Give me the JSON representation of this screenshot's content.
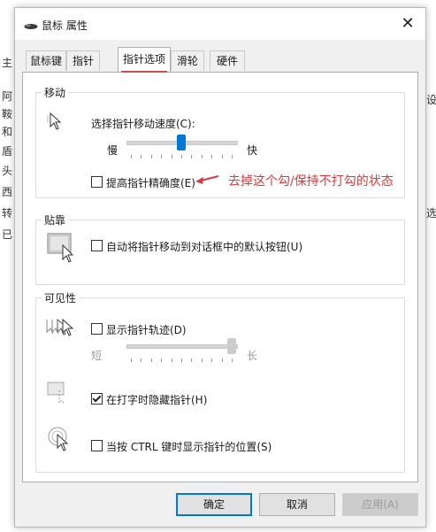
{
  "window": {
    "title": "鼠标 属性",
    "close_label": "✕"
  },
  "tabs": [
    "鼠标键",
    "指针",
    "指针选项",
    "滑轮",
    "硬件"
  ],
  "motion": {
    "group_label": "移动",
    "speed_label": "选择指针移动速度(C):",
    "slow_label": "慢",
    "fast_label": "快",
    "speed_value": 0.5,
    "precision_label": "提高指针精确度(E)",
    "precision_checked": false
  },
  "annotation": "去掉这个勾/保持不打勾的状态",
  "snap": {
    "group_label": "贴靠",
    "snap_label": "自动将指针移动到对话框中的默认按钮(U)",
    "snap_checked": false
  },
  "visibility": {
    "group_label": "可见性",
    "trails_label": "显示指针轨迹(D)",
    "trails_checked": false,
    "short_label": "短",
    "long_label": "长",
    "trails_value": 1.0,
    "hide_label": "在打字时隐藏指针(H)",
    "hide_checked": true,
    "ctrl_label": "当按 CTRL 键时显示指针的位置(S)",
    "ctrl_checked": false
  },
  "buttons": {
    "ok": "确定",
    "cancel": "取消",
    "apply": "应用(A)"
  },
  "colors": {
    "accent": "#0078d7",
    "annotation": "#d83b3b"
  },
  "bg_fragments": [
    "主",
    "阿",
    "鞍",
    "和",
    "盾",
    "头",
    "西",
    "转",
    "已",
    "设",
    "选"
  ]
}
